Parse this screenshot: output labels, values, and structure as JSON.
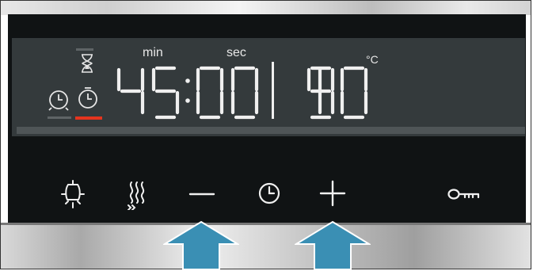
{
  "display": {
    "unit_min": "min",
    "unit_sec": "sec",
    "unit_temp": "°C",
    "time_digits": [
      "4",
      "5",
      "0",
      "0"
    ],
    "temp_digits": [
      "1",
      "9",
      "0"
    ],
    "active_timer_indicator_color": "#e5341e"
  },
  "controls": [
    {
      "id": "light",
      "icon": "lamp-icon"
    },
    {
      "id": "heating",
      "icon": "heat-mode-icon"
    },
    {
      "id": "minus",
      "icon": "minus-icon"
    },
    {
      "id": "clock",
      "icon": "clock-icon"
    },
    {
      "id": "plus",
      "icon": "plus-icon"
    },
    {
      "id": "lock",
      "icon": "key-icon"
    }
  ],
  "annotation_arrow_color": "#3a8fb4",
  "highlighted_buttons": [
    "minus",
    "plus"
  ]
}
